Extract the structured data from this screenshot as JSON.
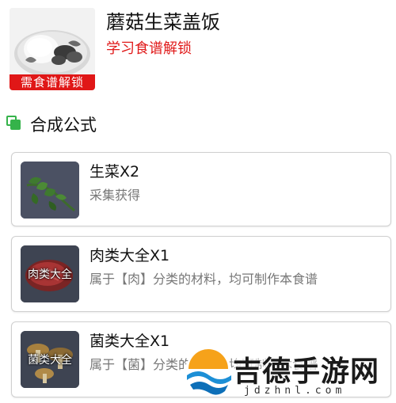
{
  "dish": {
    "title": "蘑菇生菜盖饭",
    "subtitle": "学习食谱解锁",
    "lock_banner": "需食谱解锁",
    "image_icon": "mushroom-lettuce-rice-dish"
  },
  "section": {
    "title": "合成公式",
    "icon": "layers-icon",
    "accent_color": "#35b34a"
  },
  "ingredients": [
    {
      "name": "生菜X2",
      "desc": "采集获得",
      "thumb_label": "",
      "icon": "lettuce-icon"
    },
    {
      "name": "肉类大全X1",
      "desc": "属于【肉】分类的材料，均可制作本食谱",
      "thumb_label": "肉类大全",
      "icon": "meat-icon"
    },
    {
      "name": "菌类大全X1",
      "desc": "属于【菌】分类的材料，均可制作本食谱",
      "thumb_label": "菌类大全",
      "icon": "mushroom-icon"
    }
  ],
  "watermark": {
    "text": "吉德手游网",
    "url": "jdzhnl.com"
  },
  "colors": {
    "lock_red": "#e01717",
    "subtitle_red": "#e01a1a",
    "card_border": "#cfcfcf"
  }
}
